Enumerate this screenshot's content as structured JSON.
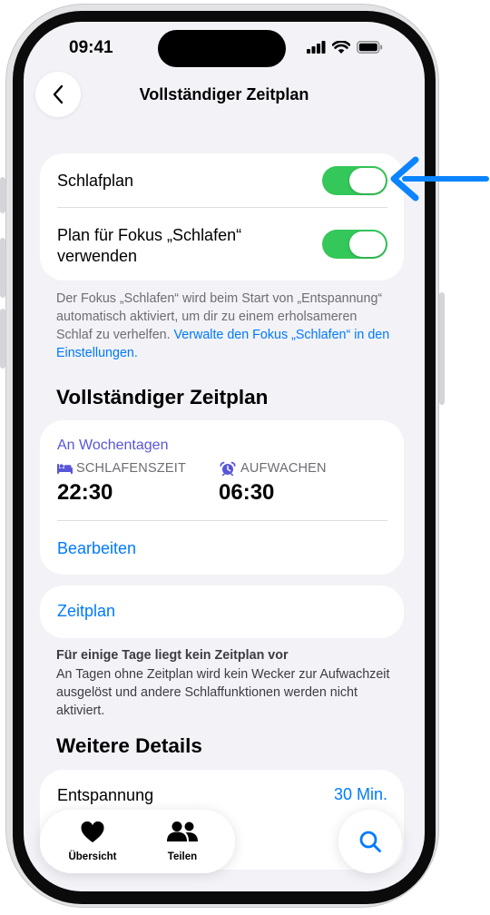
{
  "status_bar": {
    "time": "09:41"
  },
  "nav": {
    "title": "Vollständiger Zeitplan"
  },
  "focus_card": {
    "sleep_schedule_label": "Schlafplan",
    "sleep_schedule_on": true,
    "focus_label_line1": "Plan für Fokus „Schlafen“",
    "focus_label_line2": "verwenden",
    "focus_on": true
  },
  "focus_footnote": {
    "text": "Der Fokus „Schlafen“ wird beim Start von „Entspannung“ automatisch aktiviert, um dir zu einem erholsameren Schlaf zu verhelfen. ",
    "link": "Verwalte den Fokus „Schlafen“ in den Einstellungen."
  },
  "full_schedule": {
    "section_title": "Vollständiger Zeitplan",
    "days_label": "An Wochentagen",
    "bedtime_label": "SCHLAFENSZEIT",
    "bedtime_value": "22:30",
    "wake_label": "AUFWACHEN",
    "wake_value": "06:30",
    "edit_label": "Bearbeiten"
  },
  "schedule_link": "Zeitplan",
  "schedule_note": {
    "title": "Für einige Tage liegt kein Zeitplan vor",
    "body": "An Tagen ohne Zeitplan wird kein Wecker zur Aufwachzeit ausgelöst und andere Schlaffunktionen werden nicht aktiviert."
  },
  "more_details": {
    "section_title": "Weitere Details",
    "wind_down_label": "Entspannung",
    "wind_down_value": "30 Min."
  },
  "tabbar": {
    "summary_label": "Übersicht",
    "sharing_label": "Teilen"
  },
  "colors": {
    "accent": "#007aff",
    "toggle_on": "#34c759",
    "section_purple": "#5856d6",
    "background": "#f2f2f7"
  },
  "icons": {
    "back": "chevron-left-icon",
    "bed": "bed-icon",
    "alarm": "alarm-clock-icon",
    "summary": "heart-icon",
    "sharing": "people-icon",
    "search": "search-icon",
    "pointer": "arrow-left-icon"
  }
}
